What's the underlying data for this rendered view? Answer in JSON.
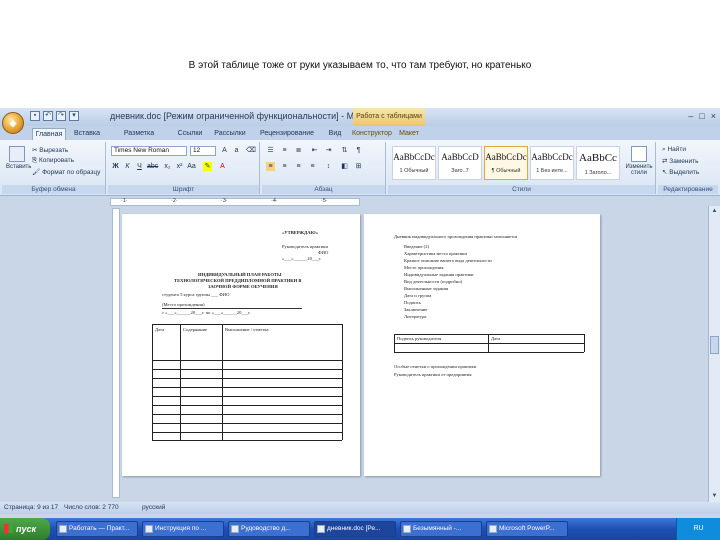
{
  "caption": "В этой таблице тоже от руки указываем то, что там требуют, но кратенько",
  "window": {
    "title": "дневник.doc [Режим ограниченной функциональности] - Mi...",
    "context_tab_title": "Работа с таблицами"
  },
  "tabs": [
    "Главная",
    "Вставка",
    "Разметка страницы",
    "Ссылки",
    "Рассылки",
    "Рецензирование",
    "Вид",
    "Конструктор",
    "Макет"
  ],
  "ribbon": {
    "clipboard": {
      "paste": "Вставить",
      "cut": "Вырезать",
      "copy": "Копировать",
      "format_painter": "Формат по образцу",
      "label": "Буфер обмена"
    },
    "font": {
      "name": "Times New Roman",
      "size": "12",
      "label": "Шрифт"
    },
    "paragraph": {
      "label": "Абзац"
    },
    "styles": {
      "items": [
        {
          "sample": "AaBbCcDc",
          "name": "1 Обычный"
        },
        {
          "sample": "AaBbCcD",
          "name": "Заго..7"
        },
        {
          "sample": "AaBbCcDc",
          "name": "¶ Обычный"
        },
        {
          "sample": "AaBbCcDc",
          "name": "1 Без инте..."
        },
        {
          "sample": "AaBbCc",
          "name": "1 Заголо..."
        }
      ],
      "change_styles": "Изменить стили",
      "label": "Стили"
    },
    "editing": {
      "find": "Найти",
      "replace": "Заменить",
      "select": "Выделить",
      "label": "Редактирование"
    }
  },
  "document": {
    "page1": {
      "approve": "«УТВЕРЖДАЮ»",
      "approve_line": "Руководитель практики",
      "approve_fio": "ФИО",
      "approve_date": "«___»______20___г.",
      "heading1": "ИНДИВИДУАЛЬНЫЙ ПЛАН РАБОТЫ",
      "heading2": "ТЕХНОЛОГИЧЕСКОЙ ПРЕДДИПЛОМНОЙ ПРАКТИКИ В",
      "heading3": "ЗАОЧНОЙ ФОРМЕ ОБУЧЕНИЯ",
      "student_line": "студента 5 курса группы ___ ФИО",
      "place_line": "(Место прохождения)",
      "period_line": "с «___»______20___г. по «___»______20___г.",
      "col1": "Дата",
      "col2": "Содержание",
      "col3": "Выполнение / отметка"
    },
    "page2": {
      "intro": "Дневник индивидуального прохождения практики заполняется",
      "lines": [
        "Введение (2)",
        "Характеристика места практики",
        "Краткое описание вашего вида деятельности",
        "Место прохождения",
        "Индивидуальные задания практики",
        "Вид деятельности (подробно)",
        "Выполненные задания",
        "Дата и группа",
        "Подпись",
        "Заключение",
        "Литература"
      ],
      "table_c1": "Подпись руководителя",
      "table_c2": "Дата",
      "note1": "Особые отметки о прохождении практики",
      "note2": "Руководитель практики от предприятия"
    }
  },
  "statusbar": {
    "page": "Страница: 9 из 17",
    "words": "Число слов: 2 770",
    "lang": "русский"
  },
  "taskbar": {
    "start": "пуск",
    "tasks": [
      "Работать — Практ...",
      "Инструкция по ...",
      "Рудоводство д...",
      "дневник.doc [Ре...",
      "Безымянный -...",
      "Microsoft PowerP..."
    ],
    "clock": "RU"
  }
}
